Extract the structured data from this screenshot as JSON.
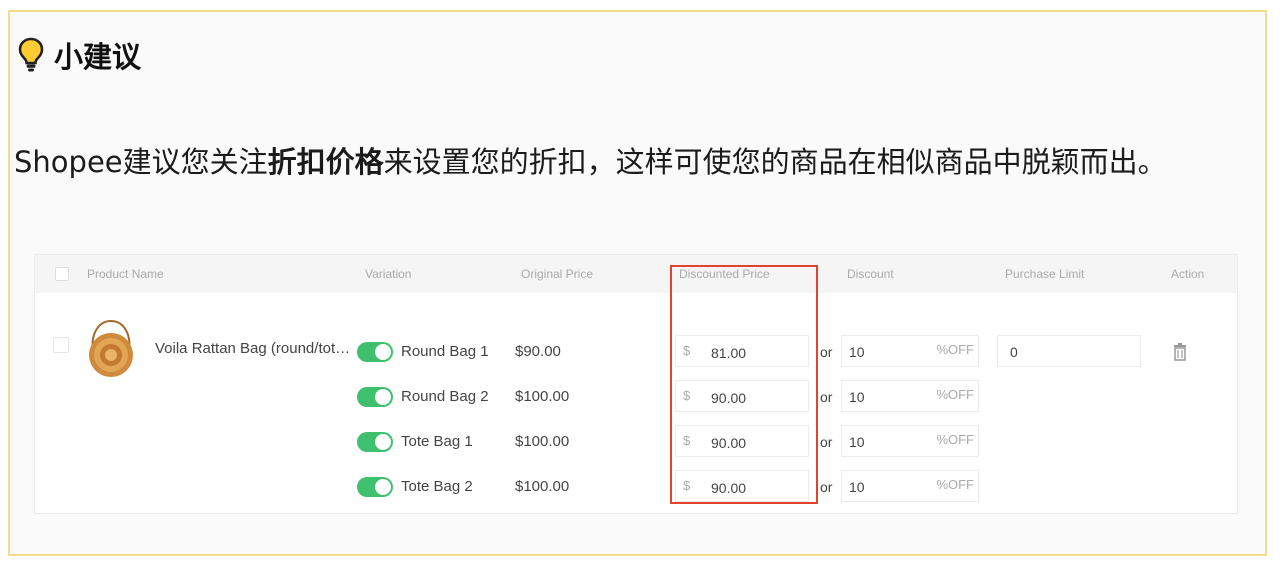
{
  "tip": {
    "title": "小建议",
    "text_before": "Shopee建议您关注",
    "text_bold": "折扣价格",
    "text_after": "来设置您的折扣，这样可使您的商品在相似商品中脱颖而出。"
  },
  "table": {
    "headers": {
      "product": "Product Name",
      "variation": "Variation",
      "original": "Original Price",
      "discounted": "Discounted Price",
      "discount": "Discount",
      "limit": "Purchase Limit",
      "action": "Action"
    },
    "product_name": "Voila Rattan Bag (round/tot…",
    "currency": "$",
    "or_label": "or",
    "off_label": "%OFF",
    "purchase_limit": "0",
    "rows": [
      {
        "variation": "Round Bag 1",
        "original": "$90.00",
        "discounted": "81.00",
        "discount": "10",
        "enabled": true
      },
      {
        "variation": "Round Bag 2",
        "original": "$100.00",
        "discounted": "90.00",
        "discount": "10",
        "enabled": true
      },
      {
        "variation": "Tote Bag 1",
        "original": "$100.00",
        "discounted": "90.00",
        "discount": "10",
        "enabled": true
      },
      {
        "variation": "Tote Bag 2",
        "original": "$100.00",
        "discounted": "90.00",
        "discount": "10",
        "enabled": true
      }
    ]
  },
  "colors": {
    "card_border": "#f3dc8a",
    "toggle_on": "#3fc06e",
    "highlight": "#e0442d"
  },
  "icons": [
    "lightbulb-icon",
    "trash-icon"
  ]
}
